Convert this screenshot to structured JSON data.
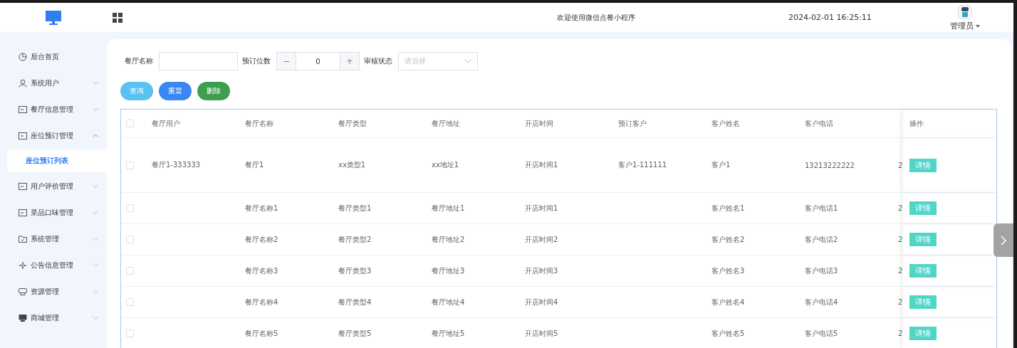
{
  "header": {
    "title": "欢迎使用微信点餐小程序",
    "datetime": "2024-02-01 16:25:11",
    "user": "管理员"
  },
  "sidebar": {
    "items": [
      {
        "kind": "link",
        "label": "后台首页"
      },
      {
        "kind": "group",
        "label": "系统用户",
        "expanded": false
      },
      {
        "kind": "group",
        "label": "餐厅信息管理",
        "expanded": false
      },
      {
        "kind": "group",
        "label": "座位预订管理",
        "expanded": true,
        "children": [
          {
            "label": "座位预订列表",
            "selected": true
          }
        ]
      },
      {
        "kind": "group",
        "label": "用户评价管理",
        "expanded": false
      },
      {
        "kind": "group",
        "label": "菜品口味管理",
        "expanded": false
      },
      {
        "kind": "group",
        "label": "系统管理",
        "expanded": false
      },
      {
        "kind": "group",
        "label": "公告信息管理",
        "expanded": false
      },
      {
        "kind": "group",
        "label": "资源管理",
        "expanded": false
      },
      {
        "kind": "group",
        "label": "商城管理",
        "expanded": false
      }
    ]
  },
  "filters": [
    {
      "kind": "text",
      "label": "餐厅名称"
    },
    {
      "kind": "stepper",
      "label": "预订位数",
      "minus": "−",
      "value": "0",
      "plus": "+"
    },
    {
      "kind": "select",
      "label": "审核状态",
      "placeholder": "请选择"
    }
  ],
  "buttons": [
    {
      "kind": "search",
      "label": "查询"
    },
    {
      "kind": "reset",
      "label": "重置"
    },
    {
      "kind": "delete",
      "label": "删除"
    }
  ],
  "table": {
    "header_checked": false,
    "columns": [
      "餐厅用户",
      "餐厅名称",
      "餐厅类型",
      "餐厅地址",
      "开店时间",
      "预订客户",
      "客户姓名",
      "客户电话"
    ],
    "action_column": "操作",
    "rows": [
      {
        "checked": false,
        "cells": [
          "餐厅1-333333",
          "餐厅1",
          "xx类型1",
          "xx地址1",
          "开店时间1",
          "客户1-111111",
          "客户1",
          "13213222222"
        ],
        "column_9": "2",
        "action": "详情"
      },
      {
        "checked": false,
        "cells": [
          null,
          "餐厅名称1",
          "餐厅类型1",
          "餐厅地址1",
          "开店时间1",
          null,
          "客户姓名1",
          "客户电话1"
        ],
        "column_9": "2",
        "action": "详情"
      },
      {
        "checked": false,
        "cells": [
          null,
          "餐厅名称2",
          "餐厅类型2",
          "餐厅地址2",
          "开店时间2",
          null,
          "客户姓名2",
          "客户电话2"
        ],
        "column_9": "2",
        "action": "详情"
      },
      {
        "checked": false,
        "cells": [
          null,
          "餐厅名称3",
          "餐厅类型3",
          "餐厅地址3",
          "开店时间3",
          null,
          "客户姓名3",
          "客户电话3"
        ],
        "column_9": "2",
        "action": "详情"
      },
      {
        "checked": false,
        "cells": [
          null,
          "餐厅名称4",
          "餐厅类型4",
          "餐厅地址4",
          "开店时间4",
          null,
          "客户姓名4",
          "客户电话4"
        ],
        "column_9": "2",
        "action": "详情"
      },
      {
        "checked": false,
        "cells": [
          null,
          "餐厅名称5",
          "餐厅类型5",
          "餐厅地址5",
          "开店时间5",
          null,
          "客户姓名5",
          "客户电话5"
        ],
        "column_9": "2",
        "action": "详情"
      }
    ]
  }
}
